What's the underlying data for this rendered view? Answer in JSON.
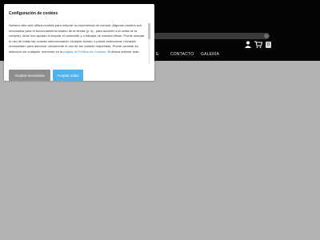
{
  "header": {
    "search_icon": "search-icon",
    "cart_icon": "cart-icon",
    "user_icon": "user-icon",
    "cart_count": "0"
  },
  "nav": {
    "items": [
      {
        "label": "E"
      },
      {
        "label": "CONTACTO"
      },
      {
        "label": "GALERÍA"
      }
    ]
  },
  "cookie_dialog": {
    "title": "Configuración de cookies",
    "body_before_link": "Nuestro sitio web utiliza cookies para mejorar su experiencia de compra. Algunas cookies son necesarias para el funcionamiento básico de la tienda (p. ej., para acceder a la cesta de la compra); otras nos ayudan a mejorar el contenido y a trabajar de manera eficaz. Puede aceptar el uso de todas las cookies seleccionando «Aceptar todas» o puede seleccionar «Aceptar necesarias» para autorizar únicamente el uso de las cookies requeridas. Puede cambiar su selección en cualquier momento en la ",
    "link_text": "página de Política de Cookies",
    "body_after_link": ". Si desea obtener más",
    "btn_necessary": "Aceptar necesarias",
    "btn_all": "Aceptar todas"
  },
  "colors": {
    "header_bg": "#050505",
    "page_bg": "#b2b2b2",
    "accent": "#4eb3ee",
    "secondary_button": "#8e8e8e"
  }
}
